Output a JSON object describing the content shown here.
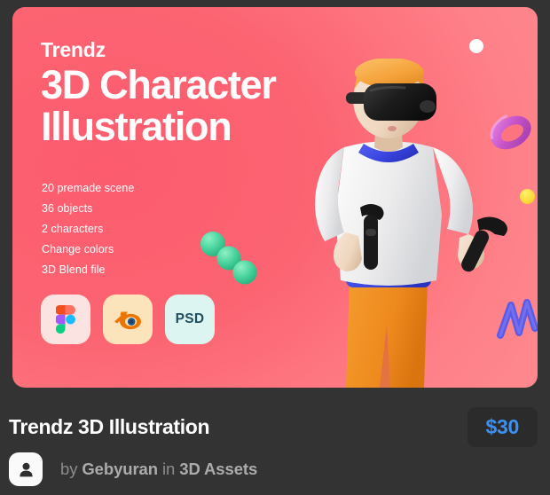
{
  "hero": {
    "brand": "Trendz",
    "headline": "3D Character Illustration",
    "features": [
      "20 premade scene",
      "36 objects",
      "2 characters",
      "Change colors",
      "3D Blend file"
    ],
    "badges": [
      {
        "name": "figma-icon",
        "label": "Figma"
      },
      {
        "name": "blender-icon",
        "label": "Blender"
      },
      {
        "name": "psd-icon",
        "label": "PSD"
      }
    ],
    "background_colors": {
      "pink_deep": "#FC5C6E",
      "pink_mid": "#FE8189",
      "pink_light": "#FF9196"
    },
    "decor": [
      {
        "name": "white-sphere",
        "color": "#FFFFFF"
      },
      {
        "name": "purple-torus",
        "color": "#C653C6"
      },
      {
        "name": "yellow-sphere",
        "color": "#FCDC3B"
      },
      {
        "name": "green-spheres",
        "color": "#4FD6A0"
      },
      {
        "name": "blue-spring",
        "color": "#5B5BE8"
      }
    ],
    "character": {
      "name": "vr-character-illustration",
      "hair_color": "#F5A33C",
      "headset_color": "#1C1C1C",
      "shirt_color": "#F1F1F1",
      "collar_color": "#3A45E0",
      "pants_color": "#EE8A1E",
      "skin_color": "#EFD7C0"
    }
  },
  "footer": {
    "title": "Trendz 3D Illustration",
    "price": "$30",
    "price_color": "#3D90F0",
    "author_prefix": "by",
    "author_name": "Gebyuran",
    "author_mid": "in",
    "category": "3D Assets",
    "avatar_icon": "user-avatar-icon"
  }
}
